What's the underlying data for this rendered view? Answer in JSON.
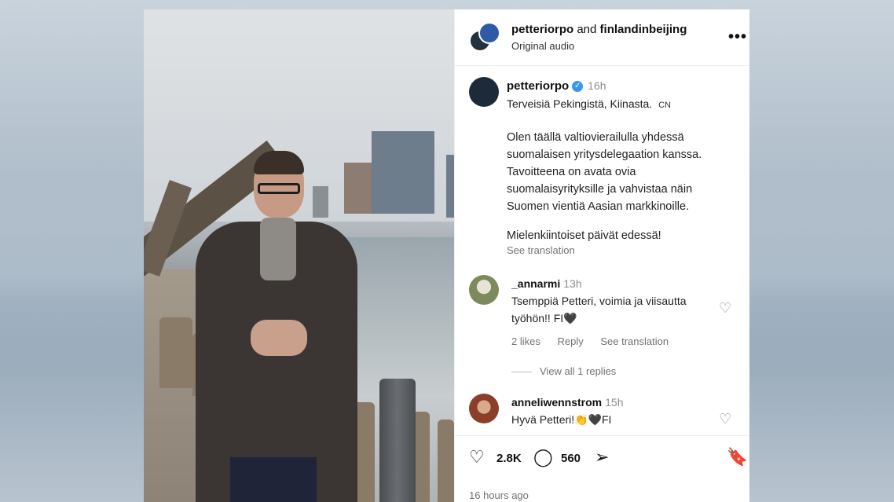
{
  "header": {
    "user1": "petteriorpo",
    "and": "and",
    "user2": "finlandinbeijing",
    "audio": "Original audio",
    "more": "•••"
  },
  "caption": {
    "username": "petteriorpo",
    "verified": "✓",
    "time": "16h",
    "line1": "Terveisiä Pekingistä, Kiinasta.",
    "country": "CN",
    "body": "Olen täällä valtiovierailulla yhdessä\nsuomalaisen yritysdelegaation kanssa.\nTavoitteena on avata ovia\nsuomalaisyrityksille ja vahvistaa näin\nSuomen vientiä Aasian markkinoille.",
    "tail": "Mielenkiintoiset päivät edessä!",
    "see_translation": "See translation"
  },
  "comments": [
    {
      "username": "_annarmi",
      "time": "13h",
      "text": "Tsemppiä Petteri, voimia ja viisautta työhön!! FI🖤",
      "likes": "2 likes",
      "reply": "Reply",
      "see_translation": "See translation",
      "view_replies": "View all 1 replies"
    },
    {
      "username": "anneliwennstrom",
      "time": "15h",
      "text": "Hyvä Petteri!👏🖤FI"
    }
  ],
  "actions": {
    "likes": "2.8K",
    "comments": "560",
    "time_ago": "16 hours ago"
  }
}
